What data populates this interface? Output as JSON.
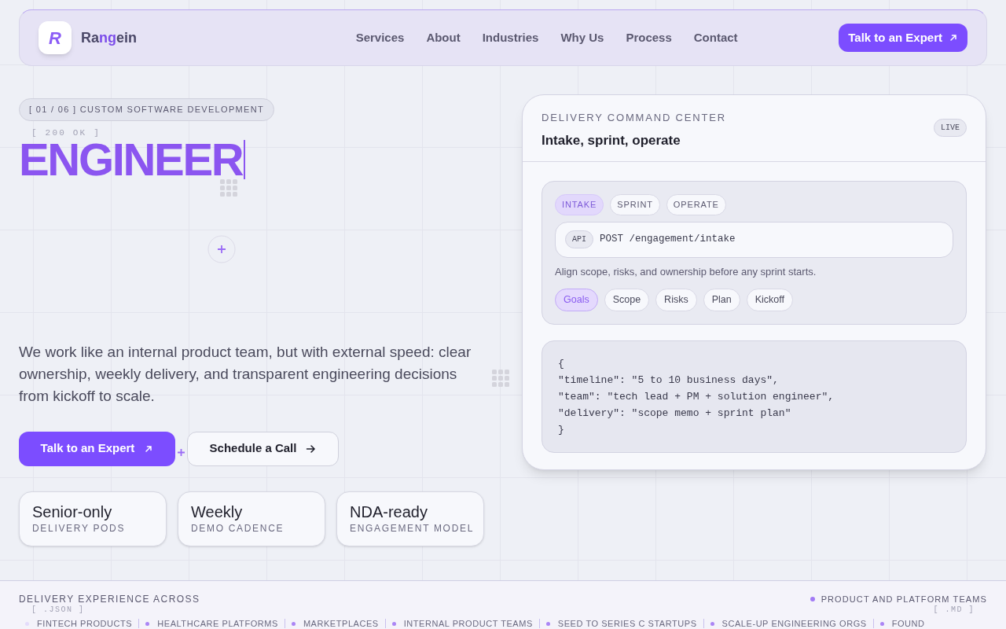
{
  "header": {
    "logo_mark": "R",
    "brand": [
      {
        "text": "Ra",
        "accent": false
      },
      {
        "text": "ng",
        "accent": true
      },
      {
        "text": "ein",
        "accent": false
      }
    ],
    "nav": [
      "Services",
      "About",
      "Industries",
      "Why Us",
      "Process",
      "Contact"
    ],
    "cta": "Talk to an Expert"
  },
  "hero": {
    "eyebrow": "[ 01 / 06 ] CUSTOM SOFTWARE DEVELOPMENT",
    "status": "[ 200 OK ]",
    "headline": "ENGINEER",
    "description": "We work like an internal product team, but with external speed: clear ownership, weekly delivery, and transparent engineering decisions from kickoff to scale.",
    "buttons": [
      {
        "label": "Talk to an Expert",
        "kind": "primary"
      },
      {
        "label": "Schedule a Call",
        "kind": "secondary"
      }
    ],
    "stats": [
      {
        "value": "Senior-only",
        "label": "DELIVERY PODS"
      },
      {
        "value": "Weekly",
        "label": "DEMO CADENCE"
      },
      {
        "value": "NDA-ready",
        "label": "ENGAGEMENT MODEL"
      }
    ]
  },
  "panel": {
    "eyebrow": "DELIVERY COMMAND CENTER",
    "title": "Intake, sprint, operate",
    "badge": "LIVE",
    "stages": [
      {
        "label": "INTAKE",
        "selected": true
      },
      {
        "label": "SPRINT",
        "selected": false
      },
      {
        "label": "OPERATE",
        "selected": false
      }
    ],
    "endpoint": {
      "method_badge": "API",
      "path": "POST /engagement/intake"
    },
    "note": "Align scope, risks, and ownership before any sprint starts.",
    "chips": [
      {
        "label": "Goals",
        "selected": true
      },
      {
        "label": "Scope",
        "selected": false
      },
      {
        "label": "Risks",
        "selected": false
      },
      {
        "label": "Plan",
        "selected": false
      },
      {
        "label": "Kickoff",
        "selected": false
      }
    ],
    "code": [
      "{",
      "\"timeline\": \"5 to 10 business days\",",
      "\"team\": \"tech lead + PM + solution engineer\",",
      "\"delivery\": \"scope memo + sprint plan\"",
      "}"
    ]
  },
  "footer": {
    "heading": "DELIVERY EXPERIENCE ACROSS",
    "highlight": "PRODUCT AND PLATFORM TEAMS",
    "file_tags": [
      "[ .JSON ]",
      "[ .MD ]"
    ],
    "ticker": [
      "FINTECH PRODUCTS",
      "HEALTHCARE PLATFORMS",
      "MARKETPLACES",
      "INTERNAL PRODUCT TEAMS",
      "SEED TO SERIES C STARTUPS",
      "SCALE-UP ENGINEERING ORGS",
      "FOUND"
    ]
  }
}
